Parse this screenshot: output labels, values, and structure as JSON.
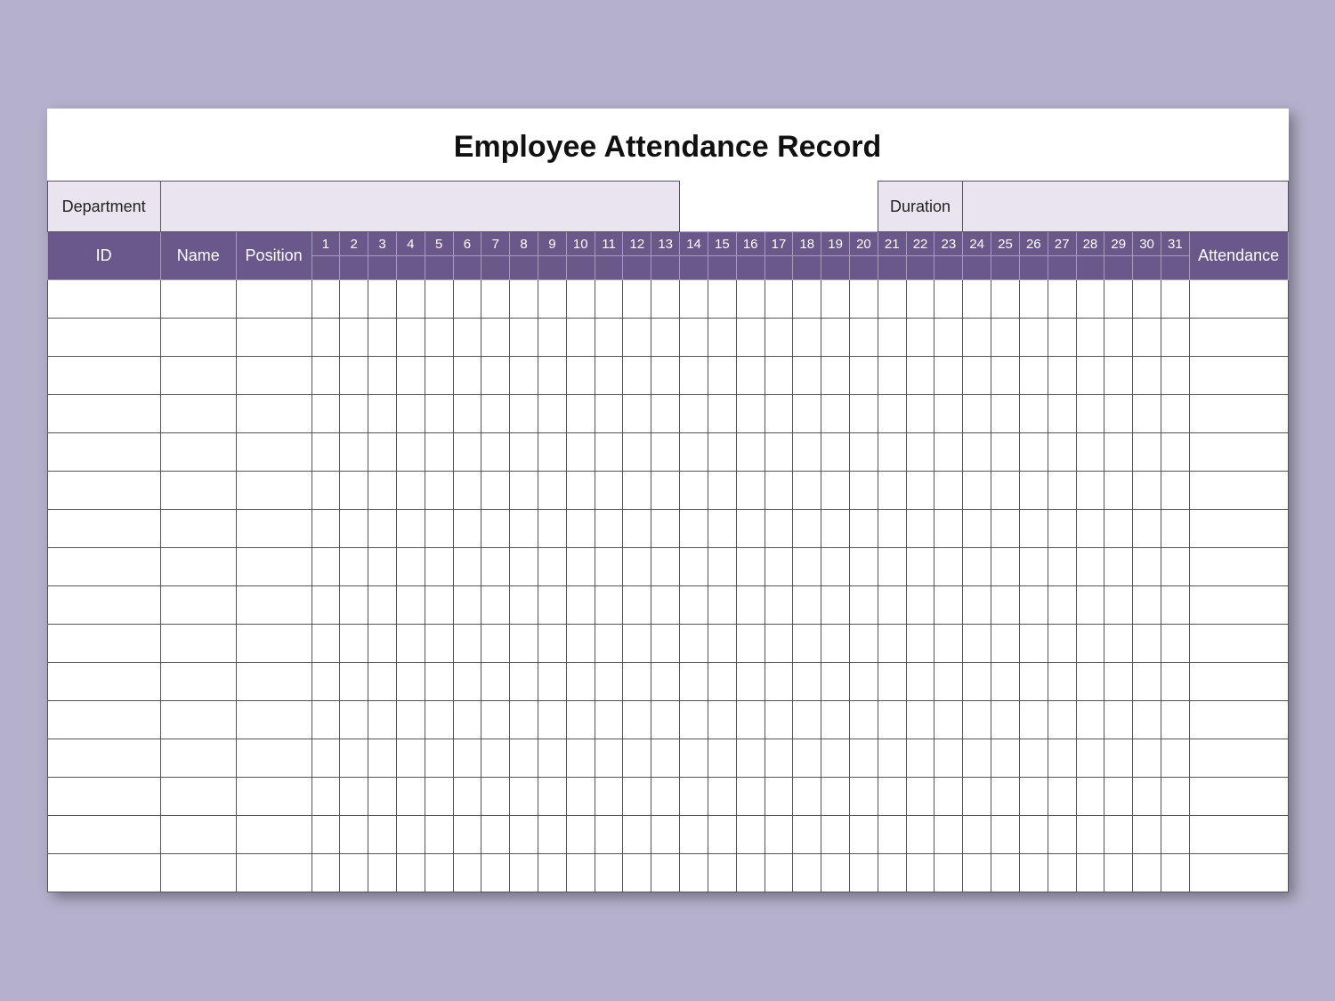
{
  "title": "Employee Attendance Record",
  "info": {
    "department_label": "Department",
    "department_value": "",
    "duration_label": "Duration",
    "duration_value": ""
  },
  "headers": {
    "id": "ID",
    "name": "Name",
    "position": "Position",
    "attendance": "Attendance",
    "days": [
      "1",
      "2",
      "3",
      "4",
      "5",
      "6",
      "7",
      "8",
      "9",
      "10",
      "11",
      "12",
      "13",
      "14",
      "15",
      "16",
      "17",
      "18",
      "19",
      "20",
      "21",
      "22",
      "23",
      "24",
      "25",
      "26",
      "27",
      "28",
      "29",
      "30",
      "31"
    ]
  },
  "rows": 16,
  "colors": {
    "page_bg": "#b5b1cc",
    "header_bg": "#6b588b",
    "info_bg": "#e9e4f0"
  }
}
